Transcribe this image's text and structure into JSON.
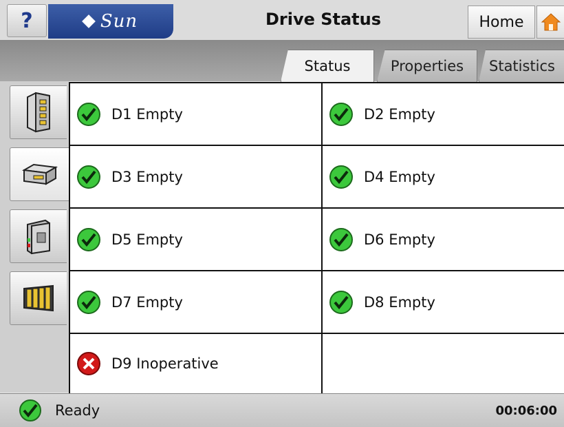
{
  "header": {
    "help_label": "?",
    "logo_text": "Sun",
    "title": "Drive Status",
    "home_label": "Home"
  },
  "tabs": [
    {
      "label": "Status",
      "active": true
    },
    {
      "label": "Properties",
      "active": false
    },
    {
      "label": "Statistics",
      "active": false
    }
  ],
  "sidebar": {
    "items": [
      {
        "icon": "library-icon",
        "selected": false
      },
      {
        "icon": "drive-icon",
        "selected": true
      },
      {
        "icon": "cartridge-icon",
        "selected": false
      },
      {
        "icon": "magazine-icon",
        "selected": false
      }
    ]
  },
  "drives": [
    {
      "label": "D1 Empty",
      "status": "ok"
    },
    {
      "label": "D2 Empty",
      "status": "ok"
    },
    {
      "label": "D3 Empty",
      "status": "ok"
    },
    {
      "label": "D4 Empty",
      "status": "ok"
    },
    {
      "label": "D5 Empty",
      "status": "ok"
    },
    {
      "label": "D6 Empty",
      "status": "ok"
    },
    {
      "label": "D7 Empty",
      "status": "ok"
    },
    {
      "label": "D8 Empty",
      "status": "ok"
    },
    {
      "label": "D9 Inoperative",
      "status": "error"
    }
  ],
  "status_bar": {
    "text": "Ready",
    "time": "00:06:00"
  },
  "colors": {
    "ok": "#3cc83c",
    "error": "#d21a1a",
    "brand": "#2a4a96",
    "home_accent": "#f08a1e"
  }
}
